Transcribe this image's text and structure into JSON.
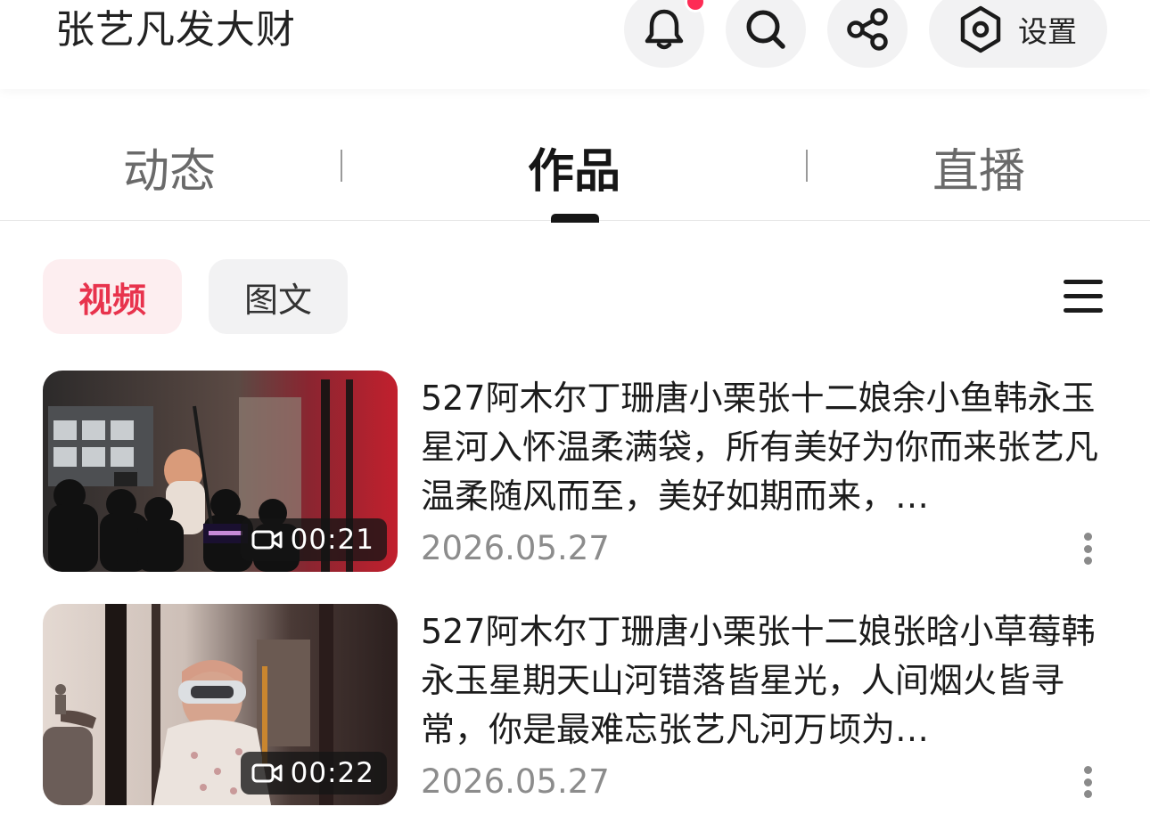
{
  "header": {
    "profile_name": "张艺凡发大财",
    "settings_label": "设置",
    "icons": [
      "bell-icon",
      "search-icon",
      "share-icon",
      "settings-icon"
    ],
    "notification_dot_color": "#fe2c55"
  },
  "tabs": [
    {
      "label": "动态",
      "active": false
    },
    {
      "label": "作品",
      "active": true
    },
    {
      "label": "直播",
      "active": false
    }
  ],
  "filters": {
    "video_label": "视频",
    "image_label": "图文",
    "active": "视频",
    "active_color": "#e8334d"
  },
  "videos": [
    {
      "title": "527阿木尔丁珊唐小栗张十二娘余小鱼韩永玉星河入怀温柔满袋，所有美好为你而来张艺凡温柔随风而至，美好如期而来，…",
      "duration": "00:21",
      "date": "2026.05.27"
    },
    {
      "title": "527阿木尔丁珊唐小栗张十二娘张晗小草莓韩永玉星期天山河错落皆星光，人间烟火皆寻常，你是最难忘张艺凡河万顷为…",
      "duration": "00:22",
      "date": "2026.05.27"
    }
  ]
}
